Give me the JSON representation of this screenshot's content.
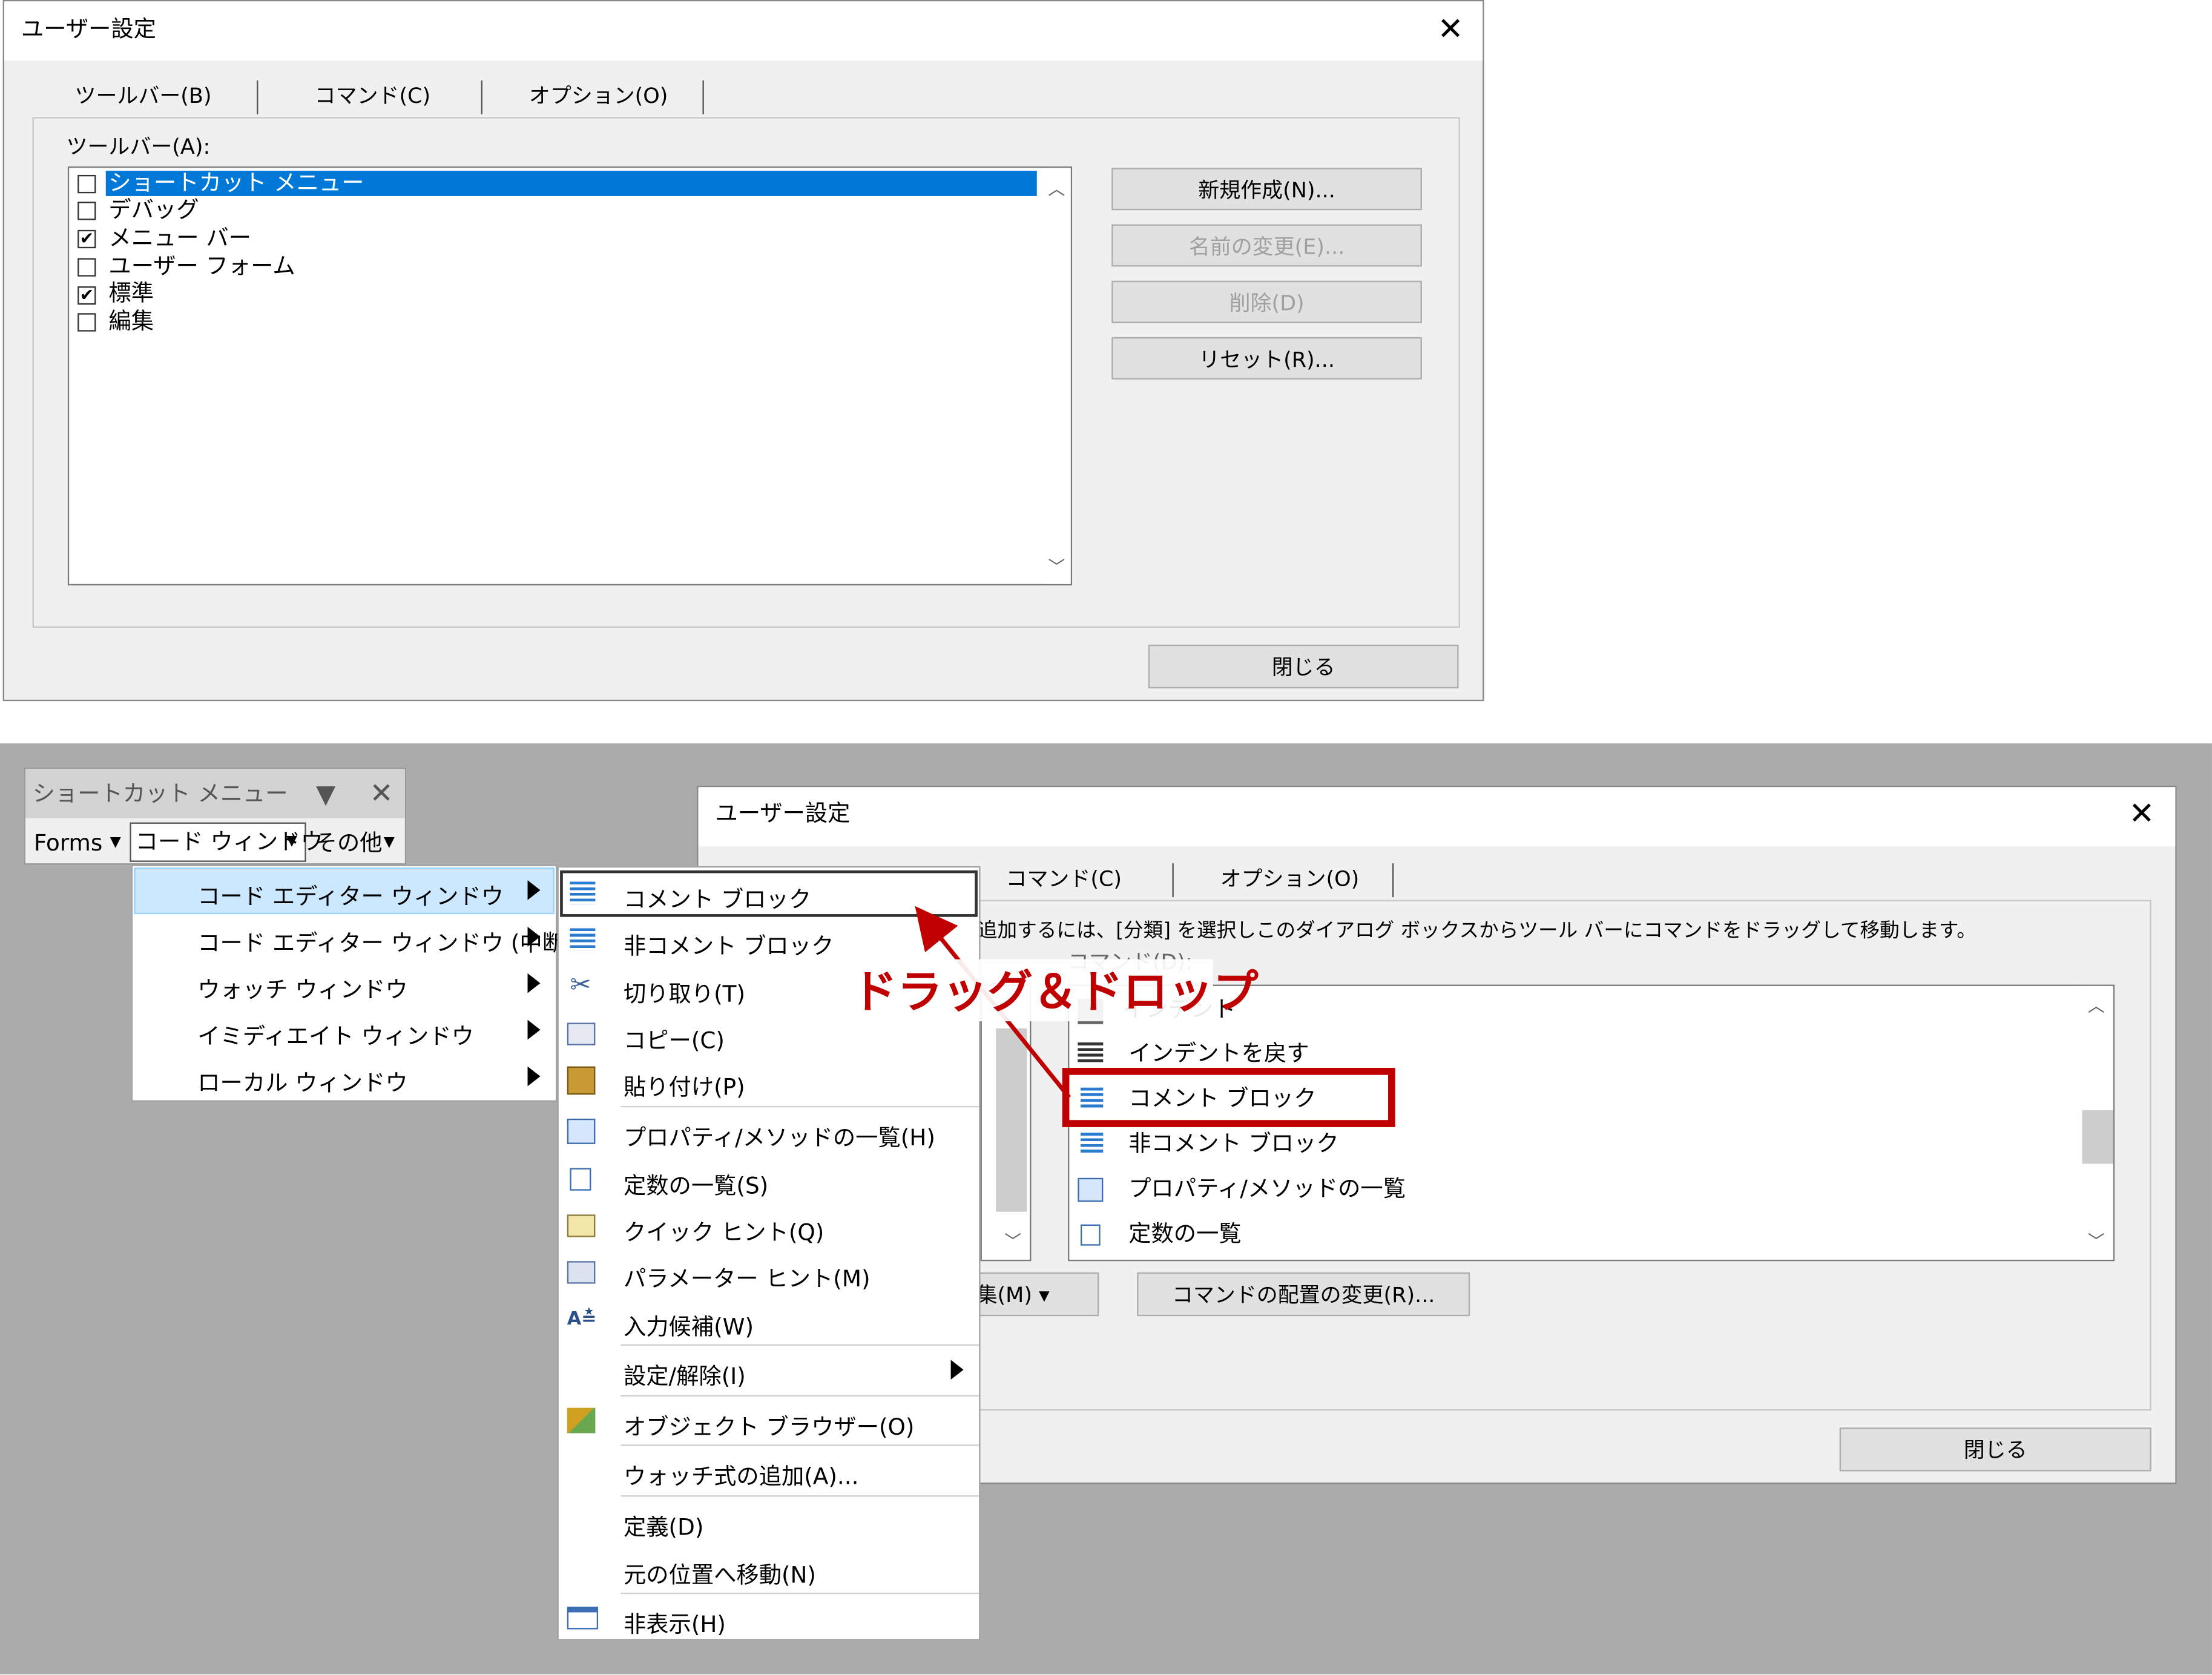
{
  "dialog1": {
    "title": "ユーザー設定",
    "tabs": [
      "ツールバー(B)",
      "コマンド(C)",
      "オプション(O)"
    ],
    "list_label": "ツールバー(A):",
    "toolbars": [
      {
        "label": "ショートカット メニュー",
        "checked": false,
        "selected": true
      },
      {
        "label": "デバッグ",
        "checked": false
      },
      {
        "label": "メニュー バー",
        "checked": true
      },
      {
        "label": "ユーザー フォーム",
        "checked": false
      },
      {
        "label": "標準",
        "checked": true
      },
      {
        "label": "編集",
        "checked": false
      }
    ],
    "buttons": {
      "new": "新規作成(N)...",
      "rename": "名前の変更(E)...",
      "delete": "削除(D)",
      "reset": "リセット(R)..."
    },
    "close": "閉じる"
  },
  "shortcut_toolbar": {
    "title": "ショートカット メニュー",
    "items": [
      "Forms",
      "コード ウィンドウ",
      "その他"
    ]
  },
  "submenu1": [
    "コード エディター ウィンドウ",
    "コード エディター ウィンドウ (中断)",
    "ウォッチ ウィンドウ",
    "イミディエイト ウィンドウ",
    "ローカル ウィンドウ"
  ],
  "submenu2": [
    "コメント ブロック",
    "非コメント ブロック",
    "切り取り(T)",
    "コピー(C)",
    "貼り付け(P)",
    "プロパティ/メソッドの一覧(H)",
    "定数の一覧(S)",
    "クイック ヒント(Q)",
    "パラメーター ヒント(M)",
    "入力候補(W)",
    "設定/解除(I)",
    "オブジェクト ブラウザー(O)",
    "ウォッチ式の追加(A)...",
    "定義(D)",
    "元の位置へ移動(N)",
    "非表示(H)"
  ],
  "dialog2": {
    "title": "ユーザー設定",
    "tabs": [
      "コマンド(C)",
      "オプション(O)"
    ],
    "instruction": "追加するには、[分類] を選択しこのダイアログ ボックスからツール バーにコマンドをドラッグして移動します。",
    "commands_label": "コマンド(D):",
    "commands": [
      "インデント",
      "インデントを戻す",
      "コメント ブロック",
      "非コメント ブロック",
      "プロパティ/メソッドの一覧",
      "定数の一覧"
    ],
    "edit_button": "集(M) ▾",
    "rearrange_button": "コマンドの配置の変更(R)...",
    "close": "閉じる"
  },
  "annotation": {
    "text": "ドラッグ＆ドロップ",
    "color": "#c00000"
  },
  "colors": {
    "selection": "#0078d7",
    "gray_bg": "#ababab",
    "dialog_bg": "#f0f0f0",
    "highlight_box": "#c00000"
  }
}
